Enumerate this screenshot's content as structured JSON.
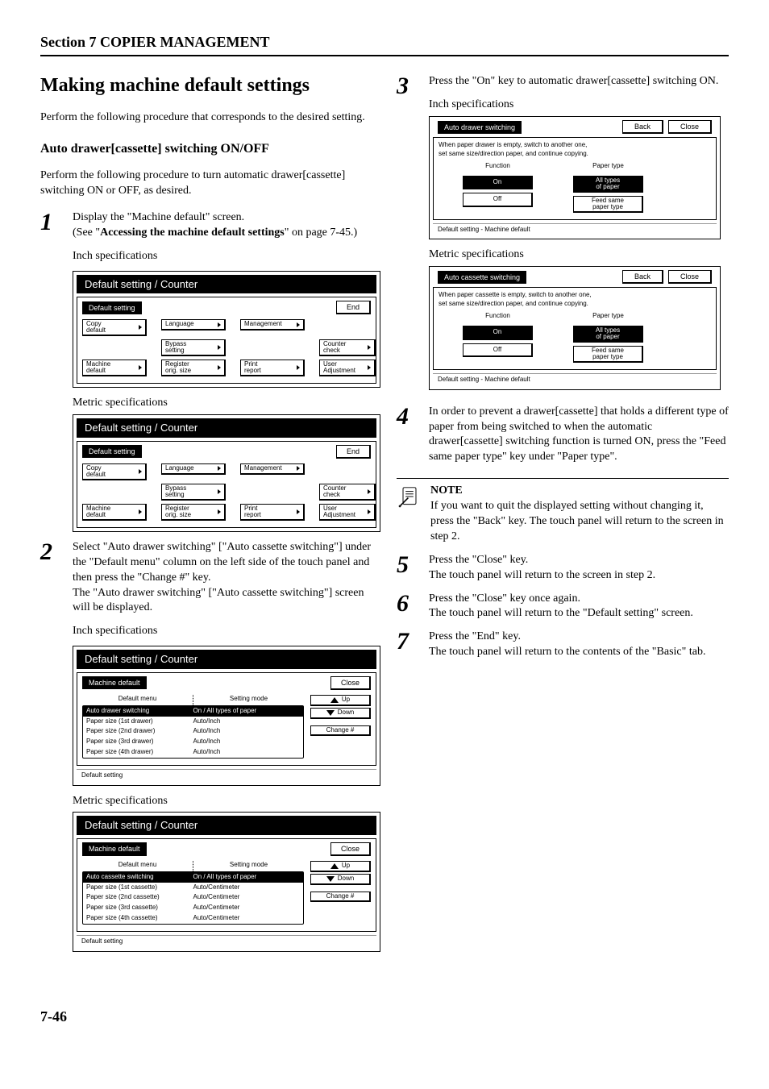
{
  "section_title": "Section 7  COPIER MANAGEMENT",
  "page_title": "Making machine default settings",
  "intro_para": "Perform the following procedure that corresponds to the desired setting.",
  "subhead_auto": "Auto drawer[cassette] switching ON/OFF",
  "auto_para": "Perform the following procedure to turn automatic drawer[cassette] switching ON or OFF, as desired.",
  "step1": {
    "line1": "Display the \"Machine default\" screen.",
    "line2_pre": "(See \"",
    "line2_bold": "Accessing the machine default settings",
    "line2_post": "\" on page 7-45.)"
  },
  "inch_caption": "Inch specifications",
  "metric_caption": "Metric specifications",
  "ui_common": {
    "titlebar": "Default setting / Counter",
    "default_setting": "Default setting",
    "machine_default": "Machine default",
    "end": "End",
    "close": "Close",
    "back": "Back",
    "up": "Up",
    "down": "Down",
    "change": "Change #",
    "default_menu": "Default menu",
    "setting_mode": "Setting mode",
    "btm_note": "Default setting",
    "btm_note_md": "Default setting - Machine default"
  },
  "ui1": {
    "copy_default": "Copy\ndefault",
    "machine_default": "Machine\ndefault",
    "language": "Language",
    "bypass": "Bypass\nsetting",
    "register": "Register\norig. size",
    "management": "Management",
    "counter": "Counter\ncheck",
    "print_report": "Print\nreport",
    "user_adjust": "User\nAdjustment"
  },
  "ui_md_inch": {
    "rows": [
      {
        "l": "Auto  drawer  switching",
        "r": "On / All types of paper",
        "sel": true
      },
      {
        "l": "Paper size (1st drawer)",
        "r": "Auto/Inch"
      },
      {
        "l": "Paper size (2nd drawer)",
        "r": "Auto/Inch"
      },
      {
        "l": "Paper size (3rd drawer)",
        "r": "Auto/Inch"
      },
      {
        "l": "Paper size (4th drawer)",
        "r": "Auto/Inch"
      }
    ]
  },
  "ui_md_metric": {
    "rows": [
      {
        "l": "Auto  cassette  switching",
        "r": "On / All types of paper",
        "sel": true
      },
      {
        "l": "Paper size (1st cassette)",
        "r": "Auto/Centimeter"
      },
      {
        "l": "Paper size (2nd cassette)",
        "r": "Auto/Centimeter"
      },
      {
        "l": "Paper size (3rd cassette)",
        "r": "Auto/Centimeter"
      },
      {
        "l": "Paper size (4th cassette)",
        "r": "Auto/Centimeter"
      }
    ]
  },
  "step2": "Select \"Auto drawer switching\" [\"Auto cassette switching\"] under the \"Default menu\" column on the left side of the touch panel and then press the \"Change #\" key.\nThe \"Auto drawer switching\" [\"Auto cassette switching\"] screen will be displayed.",
  "step3": "Press the \"On\" key to automatic drawer[cassette] switching ON.",
  "ui_ds_inch": {
    "title": "Auto drawer switching",
    "msg1": "When paper drawer is empty, switch to another one,",
    "msg2": "set same size/direction paper, and continue copying."
  },
  "ui_ds_metric": {
    "title": "Auto cassette switching",
    "msg1": "When paper cassette is empty, switch to another one,",
    "msg2": "set same size/direction paper, and continue copying."
  },
  "ui_ds_labels": {
    "function": "Function",
    "paper_type": "Paper type",
    "on": "On",
    "off": "Off",
    "all_types": "All types\nof paper",
    "feed_same": "Feed same\npaper type"
  },
  "step4": "In order to prevent a drawer[cassette] that holds a different type of paper from being switched to when the automatic drawer[cassette] switching function is turned ON, press the \"Feed same paper type\" key under \"Paper type\".",
  "note": {
    "title": "NOTE",
    "body": "If you want to quit the displayed setting without changing it, press the \"Back\" key. The touch panel will return to the screen in step 2."
  },
  "step5": "Press the \"Close\" key.\nThe touch panel will return to the screen in step 2.",
  "step6": "Press the \"Close\" key once again.\nThe touch panel will return to the \"Default setting\" screen.",
  "step7": "Press the \"End\" key.\nThe touch panel will return to the contents of the \"Basic\" tab.",
  "page_num": "7-46"
}
